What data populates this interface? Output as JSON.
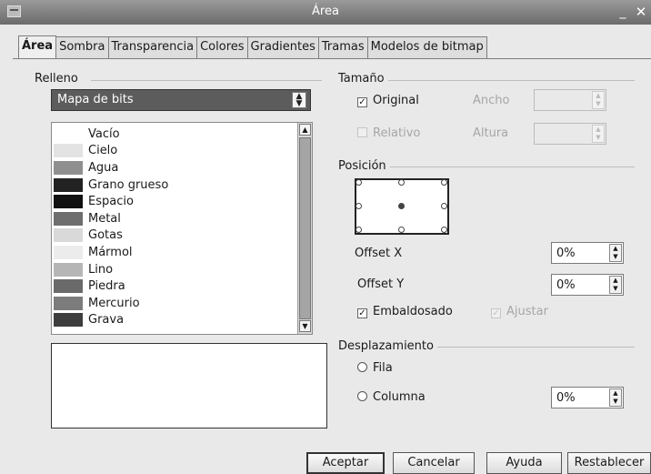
{
  "window": {
    "title": "Área",
    "minimize": "_",
    "close": "✕"
  },
  "tabs": [
    "Área",
    "Sombra",
    "Transparencia",
    "Colores",
    "Gradientes",
    "Tramas",
    "Modelos de bitmap"
  ],
  "relleno": {
    "label": "Relleno",
    "type_selected": "Mapa de bits",
    "bitmaps": [
      {
        "name": "Vacío",
        "color": "#ffffff"
      },
      {
        "name": "Cielo",
        "color": "#e3e3e3"
      },
      {
        "name": "Agua",
        "color": "#8f8f8f"
      },
      {
        "name": "Grano grueso",
        "color": "#222222"
      },
      {
        "name": "Espacio",
        "color": "#111111"
      },
      {
        "name": "Metal",
        "color": "#6e6e6e"
      },
      {
        "name": "Gotas",
        "color": "#d9d9d9"
      },
      {
        "name": "Mármol",
        "color": "#ececec"
      },
      {
        "name": "Lino",
        "color": "#b5b5b5"
      },
      {
        "name": "Piedra",
        "color": "#6a6a6a"
      },
      {
        "name": "Mercurio",
        "color": "#7c7c7c"
      },
      {
        "name": "Grava",
        "color": "#3d3d3d"
      }
    ]
  },
  "tamano": {
    "label": "Tamaño",
    "original": {
      "label": "Original",
      "checked": true
    },
    "relativo": {
      "label": "Relativo",
      "checked": false,
      "enabled": false
    },
    "ancho_label": "Ancho",
    "altura_label": "Altura",
    "ancho_value": "",
    "altura_value": ""
  },
  "posicion": {
    "label": "Posición",
    "offset_x_label": "Offset X",
    "offset_x_value": "0%",
    "offset_y_label": "Offset Y",
    "offset_y_value": "0%",
    "embaldosado": {
      "label": "Embaldosado",
      "checked": true
    },
    "ajustar": {
      "label": "Ajustar",
      "checked": true,
      "enabled": false
    }
  },
  "desplazamiento": {
    "label": "Desplazamiento",
    "fila_label": "Fila",
    "columna_label": "Columna",
    "value": "0%"
  },
  "buttons": {
    "ok": "Aceptar",
    "cancel": "Cancelar",
    "help": "Ayuda",
    "reset": "Restablecer"
  }
}
